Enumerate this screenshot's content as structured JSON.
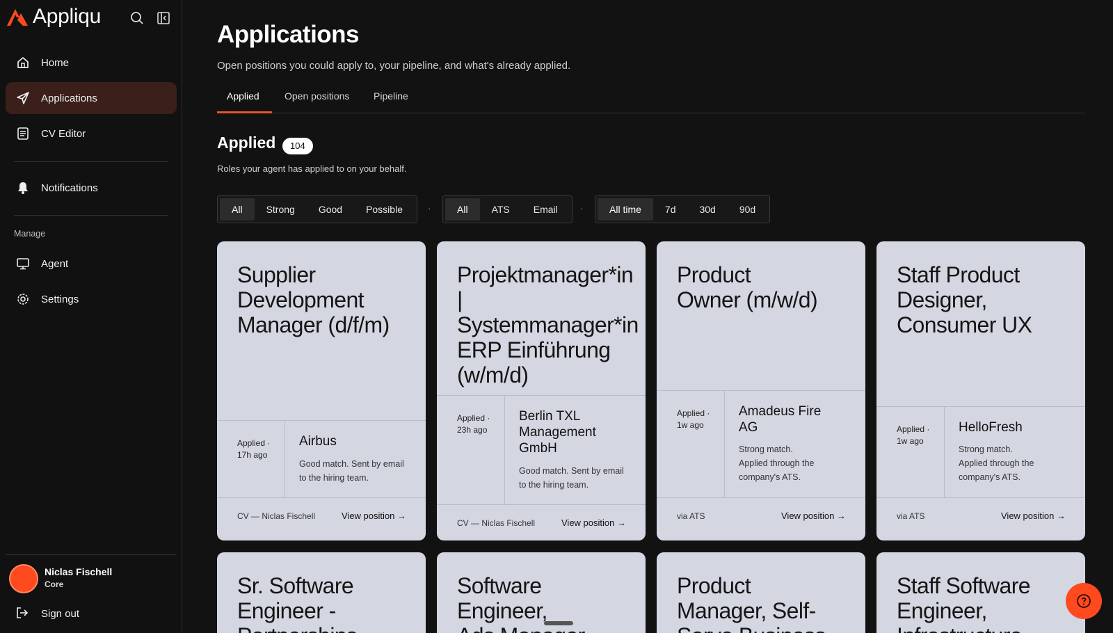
{
  "app": {
    "name": "Appliqu",
    "accent": "#ff4a1f"
  },
  "sidebar": {
    "nav": [
      {
        "label": "Home",
        "icon": "home-icon"
      },
      {
        "label": "Applications",
        "icon": "send-icon",
        "active": true
      },
      {
        "label": "CV Editor",
        "icon": "document-icon"
      },
      {
        "label": "Notifications",
        "icon": "bell-icon"
      }
    ],
    "manage_label": "Manage",
    "manage": [
      {
        "label": "Agent",
        "icon": "monitor-icon"
      },
      {
        "label": "Settings",
        "icon": "gear-icon"
      }
    ],
    "user": {
      "name": "Niclas Fischell",
      "plan": "Core"
    },
    "sign_out": "Sign out"
  },
  "page": {
    "title": "Applications",
    "subtitle": "Open positions you could apply to, your pipeline, and what's already applied.",
    "tabs": [
      {
        "label": "Applied",
        "active": true
      },
      {
        "label": "Open positions"
      },
      {
        "label": "Pipeline"
      }
    ]
  },
  "section": {
    "title": "Applied",
    "count": "104",
    "subtitle": "Roles your agent has applied to on your behalf."
  },
  "filters": {
    "match": {
      "options": [
        "All",
        "Strong",
        "Good",
        "Possible"
      ],
      "selected": "All"
    },
    "channel": {
      "options": [
        "All",
        "ATS",
        "Email"
      ],
      "selected": "All"
    },
    "time": {
      "options": [
        "All time",
        "7d",
        "30d",
        "90d"
      ],
      "selected": "All time"
    },
    "separator": "·"
  },
  "cards": [
    {
      "title": [
        "Supplier",
        "Development",
        "Manager (d/f/m)"
      ],
      "when": [
        "Applied ·",
        "17h ago"
      ],
      "company": [
        "Airbus"
      ],
      "note": [
        "Good match. Sent by email",
        "to the hiring team."
      ],
      "source": "CV — Niclas Fischell",
      "action": "View position"
    },
    {
      "title": [
        "Projektmanager*in",
        "|",
        "Systemmanager*in",
        "ERP Einführung",
        "(w/m/d)"
      ],
      "when": [
        "Applied ·",
        "23h ago"
      ],
      "company": [
        "Berlin TXL",
        "Management",
        "GmbH"
      ],
      "note": [
        "Good match. Sent by email",
        "to the hiring team."
      ],
      "source": "CV — Niclas Fischell",
      "action": "View position"
    },
    {
      "title": [
        "Product",
        "Owner (m/w/d)"
      ],
      "when": [
        "Applied ·",
        "1w ago"
      ],
      "company": [
        "Amadeus Fire",
        "AG"
      ],
      "note": [
        "Strong match.",
        "Applied through the",
        "company's ATS."
      ],
      "source": "via ATS",
      "action": "View position"
    },
    {
      "title": [
        "Staff Product",
        "Designer,",
        "Consumer UX"
      ],
      "when": [
        "Applied ·",
        "1w ago"
      ],
      "company": [
        "HelloFresh"
      ],
      "note": [
        "Strong match.",
        "Applied through the",
        "company's ATS."
      ],
      "source": "via ATS",
      "action": "View position"
    },
    {
      "title": [
        "Sr. Software",
        "Engineer -",
        "Partnerships"
      ]
    },
    {
      "title": [
        "Software",
        "Engineer,",
        "Ads Manager"
      ]
    },
    {
      "title": [
        "Product",
        "Manager, Self-",
        "Serve Business"
      ]
    },
    {
      "title": [
        "Staff Software",
        "Engineer,",
        "Infrastructure"
      ]
    }
  ]
}
